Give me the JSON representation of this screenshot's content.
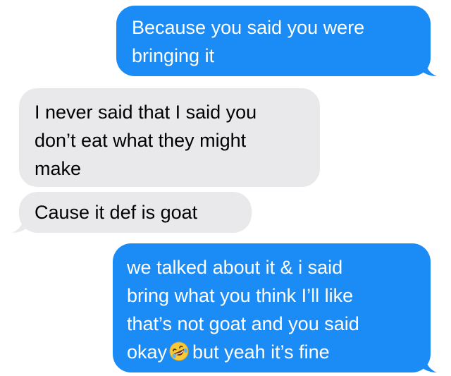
{
  "messages": [
    {
      "id": "m1",
      "direction": "sent",
      "lines": [
        "Because you said you were",
        "bringing it"
      ]
    },
    {
      "id": "m2",
      "direction": "received",
      "lines": [
        "I never said that I said you",
        "don’t eat what they might",
        "make"
      ]
    },
    {
      "id": "m3",
      "direction": "received",
      "lines": [
        "Cause it def is goat"
      ]
    },
    {
      "id": "m4",
      "direction": "sent",
      "lines": [
        "we talked about it & i said",
        "bring what you think I’ll like",
        "that’s not goat and you said",
        "okay"
      ],
      "line4_after_emoji": "but yeah it’s fine",
      "emoji": "rofl-emoji"
    }
  ],
  "colors": {
    "sent_bubble": "#1b8cf5",
    "received_bubble": "#e9e9eb",
    "sent_text": "#ffffff",
    "received_text": "#000000"
  }
}
